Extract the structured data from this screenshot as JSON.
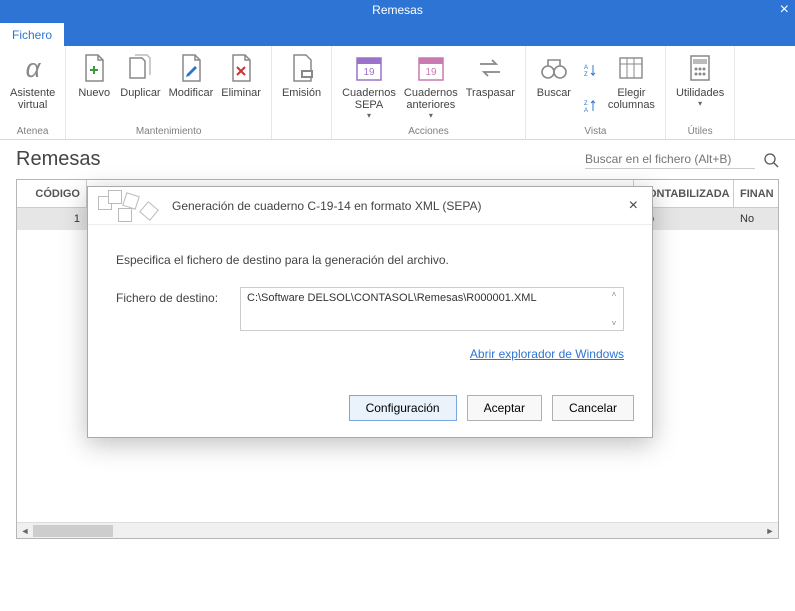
{
  "window": {
    "title": "Remesas",
    "close_glyph": "×"
  },
  "tabs": {
    "fichero": "Fichero"
  },
  "ribbon": {
    "atenea": {
      "label": "Atenea",
      "items": {
        "asistente": "Asistente\nvirtual"
      }
    },
    "mantenimiento": {
      "label": "Mantenimiento",
      "items": {
        "nuevo": "Nuevo",
        "duplicar": "Duplicar",
        "modificar": "Modificar",
        "eliminar": "Eliminar"
      }
    },
    "emision_group": {
      "items": {
        "emision": "Emisión"
      }
    },
    "acciones": {
      "label": "Acciones",
      "items": {
        "cuadernos_sepa": "Cuadernos\nSEPA",
        "cuadernos_anteriores": "Cuadernos\nanteriores",
        "traspasar": "Traspasar"
      }
    },
    "vista": {
      "label": "Vista",
      "items": {
        "buscar": "Buscar",
        "elegir_columnas": "Elegir\ncolumnas"
      }
    },
    "utiles": {
      "label": "Útiles",
      "items": {
        "utilidades": "Utilidades"
      }
    },
    "dropdown_glyph": "▾"
  },
  "page": {
    "title": "Remesas",
    "search_placeholder": "Buscar en el fichero (Alt+B)"
  },
  "grid": {
    "columns": {
      "codigo": "CÓDIGO",
      "contabilizada": "CONTABILIZADA",
      "finan": "FINAN"
    },
    "row1": {
      "codigo": "1",
      "contabilizada": "No",
      "finan": "No"
    }
  },
  "dialog": {
    "title": "Generación de cuaderno C-19-14 en formato XML (SEPA)",
    "desc": "Especifica el fichero de destino para la generación del archivo.",
    "field_label": "Fichero de destino:",
    "field_value": "C:\\Software DELSOL\\CONTASOL\\Remesas\\R000001.XML",
    "explorer_link": "Abrir explorador de Windows",
    "btn_config": "Configuración",
    "btn_accept": "Aceptar",
    "btn_cancel": "Cancelar",
    "close_glyph": "×"
  }
}
